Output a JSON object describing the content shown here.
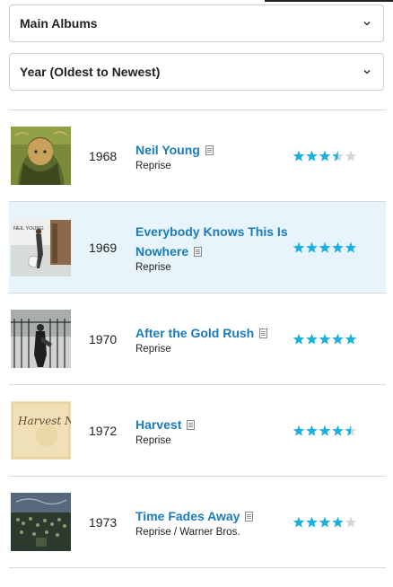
{
  "filters": {
    "category": "Main Albums",
    "sort": "Year (Oldest to Newest)"
  },
  "albums": [
    {
      "year": "1968",
      "title": "Neil Young",
      "label": "Reprise",
      "rating": 3.5,
      "highlighted": false,
      "cover_text": ""
    },
    {
      "year": "1969",
      "title": "Everybody Knows This Is Nowhere",
      "label": "Reprise",
      "rating": 5,
      "highlighted": true,
      "cover_text": "NEIL YOUNG"
    },
    {
      "year": "1970",
      "title": "After the Gold Rush",
      "label": "Reprise",
      "rating": 5,
      "highlighted": false,
      "cover_text": ""
    },
    {
      "year": "1972",
      "title": "Harvest",
      "label": "Reprise",
      "rating": 4.5,
      "highlighted": false,
      "cover_text": "Harvest Neil Young"
    },
    {
      "year": "1973",
      "title": "Time Fades Away",
      "label": "Reprise / Warner Bros.",
      "rating": 4,
      "highlighted": false,
      "cover_text": ""
    }
  ],
  "colors": {
    "link": "#1a7bbd",
    "star_on": "#1ab0e0",
    "star_off": "#d6d6d6",
    "highlight_bg": "#e7f4fb"
  },
  "icons": {
    "dropdown": "chevron-down-icon",
    "review": "document-icon",
    "rating": "star-icon"
  }
}
